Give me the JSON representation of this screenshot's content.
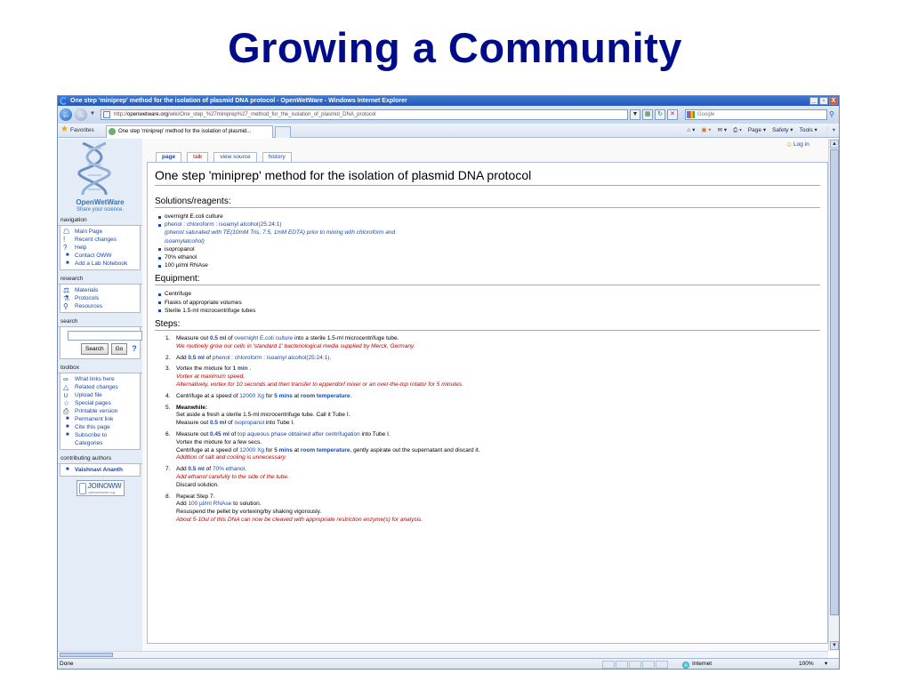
{
  "slide": {
    "title": "Growing a Community"
  },
  "window": {
    "title": "One step 'miniprep' method for the isolation of plasmid DNA protocol - OpenWetWare - Windows Internet Explorer",
    "controls": [
      "_",
      "▫",
      "X"
    ]
  },
  "address": {
    "url_prefix": "http://",
    "url_domain": "openwetware.org",
    "url_path": "/wiki/One_step_%27miniprep%27_method_for_the_isolation_of_plasmid_DNA_protocol",
    "search_placeholder": "Google"
  },
  "favbar": {
    "favorites_label": "Favorites",
    "tab_title": "One step 'miniprep' method for the isolation of plasmid...",
    "commands": [
      "Page ▾",
      "Safety ▾",
      "Tools ▾"
    ]
  },
  "sidebar": {
    "brand": "OpenWetWare",
    "tagline": "Share your science.",
    "navigation": {
      "heading": "navigation",
      "items": [
        "Main Page",
        "Recent changes",
        "Help",
        "Contact OWW",
        "Add a Lab Notebook"
      ]
    },
    "research": {
      "heading": "research",
      "items": [
        "Materials",
        "Protocols",
        "Resources"
      ]
    },
    "search": {
      "heading": "search",
      "search_button": "Search",
      "go_button": "Go",
      "help": "?"
    },
    "toolbox": {
      "heading": "toolbox",
      "items": [
        "What links here",
        "Related changes",
        "Upload file",
        "Special pages",
        "Printable version",
        "Permanent link",
        "Cite this page",
        "Subscribe to",
        "Categories"
      ]
    },
    "contributing": {
      "heading": "contributing authors",
      "items": [
        "Vaishnavi Ananth"
      ]
    },
    "join": {
      "big": "JOINOWW",
      "small": "openwetware.org"
    }
  },
  "tabs": [
    "page",
    "talk",
    "view source",
    "history"
  ],
  "login": "Log in",
  "article": {
    "title": "One step 'miniprep' method for the isolation of plasmid DNA protocol",
    "solutions_heading": "Solutions/reagents:",
    "solutions": {
      "s1": "overnight E.coli culture",
      "s2": "phenol : chloroform : isoamyl alcohol(25:24:1)",
      "s2_note1": "(phenol saturated with TE(10mM Tris, 7.5, 1mM EDTA) prior to mixing with chloroform and",
      "s2_note2": "isoamylalcohol)",
      "s3": "isopropanol",
      "s4": "70% ethanol",
      "s5": "100 µl/ml RNAse"
    },
    "equipment_heading": "Equipment:",
    "equipment": [
      "Centrifuge",
      "Flasks of appropriate volumes",
      "Sterile 1.5-ml microcentrifuge tubes"
    ],
    "steps_heading": "Steps:",
    "steps": {
      "n1": "1.",
      "n2": "2.",
      "n3": "3.",
      "n4": "4.",
      "n5": "5.",
      "n6": "6.",
      "n7": "7.",
      "n8": "8.",
      "s1_a": "Measure out ",
      "s1_v": "0.5 ml",
      "s1_b": " of ",
      "s1_l": "overnight E.coli culture",
      "s1_c": " into a sterile 1.5-ml microcentrifuge tube.",
      "s1_note": "We routinely grow our cells in 'standard 1' bacteriological media supplied by Merck, Germany.",
      "s2_a": "Add ",
      "s2_v": "0.5 ml",
      "s2_b": " of ",
      "s2_l": "phenol : chloroform : isoamyl alcohol(25:24:1)",
      "s2_c": ".",
      "s3_a": "Vortex the mixture for ",
      "s3_v": "1 min",
      "s3_c": " .",
      "s3_note1": "Vortex at maximum speed.",
      "s3_note2": "Alternatively, vortex for 10 seconds and then transfer to eppendorf mixer or an over-the-top rotator for 5 minutes.",
      "s4_a": "Centrifuge at a speed of ",
      "s4_l": "12000 Xg",
      "s4_b": " for ",
      "s4_v": "5 mins",
      "s4_c": " at ",
      "s4_v2": "room temperature",
      "s4_d": ".",
      "s5_bold": "Meanwhile:",
      "s5_l1": "Set aside a fresh a sterile 1.5-ml microcentrifuge tube. Call it Tube I.",
      "s5_a": "Measure out ",
      "s5_v": "0.5 ml",
      "s5_b": " of ",
      "s5_l": "isopropanol",
      "s5_c": " into Tube I.",
      "s6_a": "Measure out ",
      "s6_v": "0.45 ml",
      "s6_b": " of ",
      "s6_l": "top aqueous phase obtained after centrifugation",
      "s6_c": " into Tube I.",
      "s6_l2": "Vortex the mixture for a few secs.",
      "s6_d": "Centrifuge at a speed of ",
      "s6_l3": "12000 Xg",
      "s6_e": " for ",
      "s6_v2": "5 mins",
      "s6_f": " at ",
      "s6_v3": "room temperature",
      "s6_g": ", gently aspirate out the supernatant and discard it.",
      "s6_note": "Addition of salt and cooling is unnecessary.",
      "s7_a": "Add ",
      "s7_v": "0.5 ml",
      "s7_b": " of ",
      "s7_l": "70% ethanol",
      "s7_c": ".",
      "s7_note": "Add ethanol carefully to the side of the tube.",
      "s7_l2": "Discard solution.",
      "s8_l1": "Repeat Step 7.",
      "s8_a": "Add ",
      "s8_l": "100 µl/ml RNAse",
      "s8_c": " to solution.",
      "s8_l2": "Resuspend the pellet by vortexing/by shaking vigorously.",
      "s8_note": "About 5-10ul of this DNA can now be cleaved with appropriate restriction enzyme(s) for analysis."
    }
  },
  "status": {
    "text": "Done",
    "zone": "Internet",
    "zoom": "100%"
  }
}
